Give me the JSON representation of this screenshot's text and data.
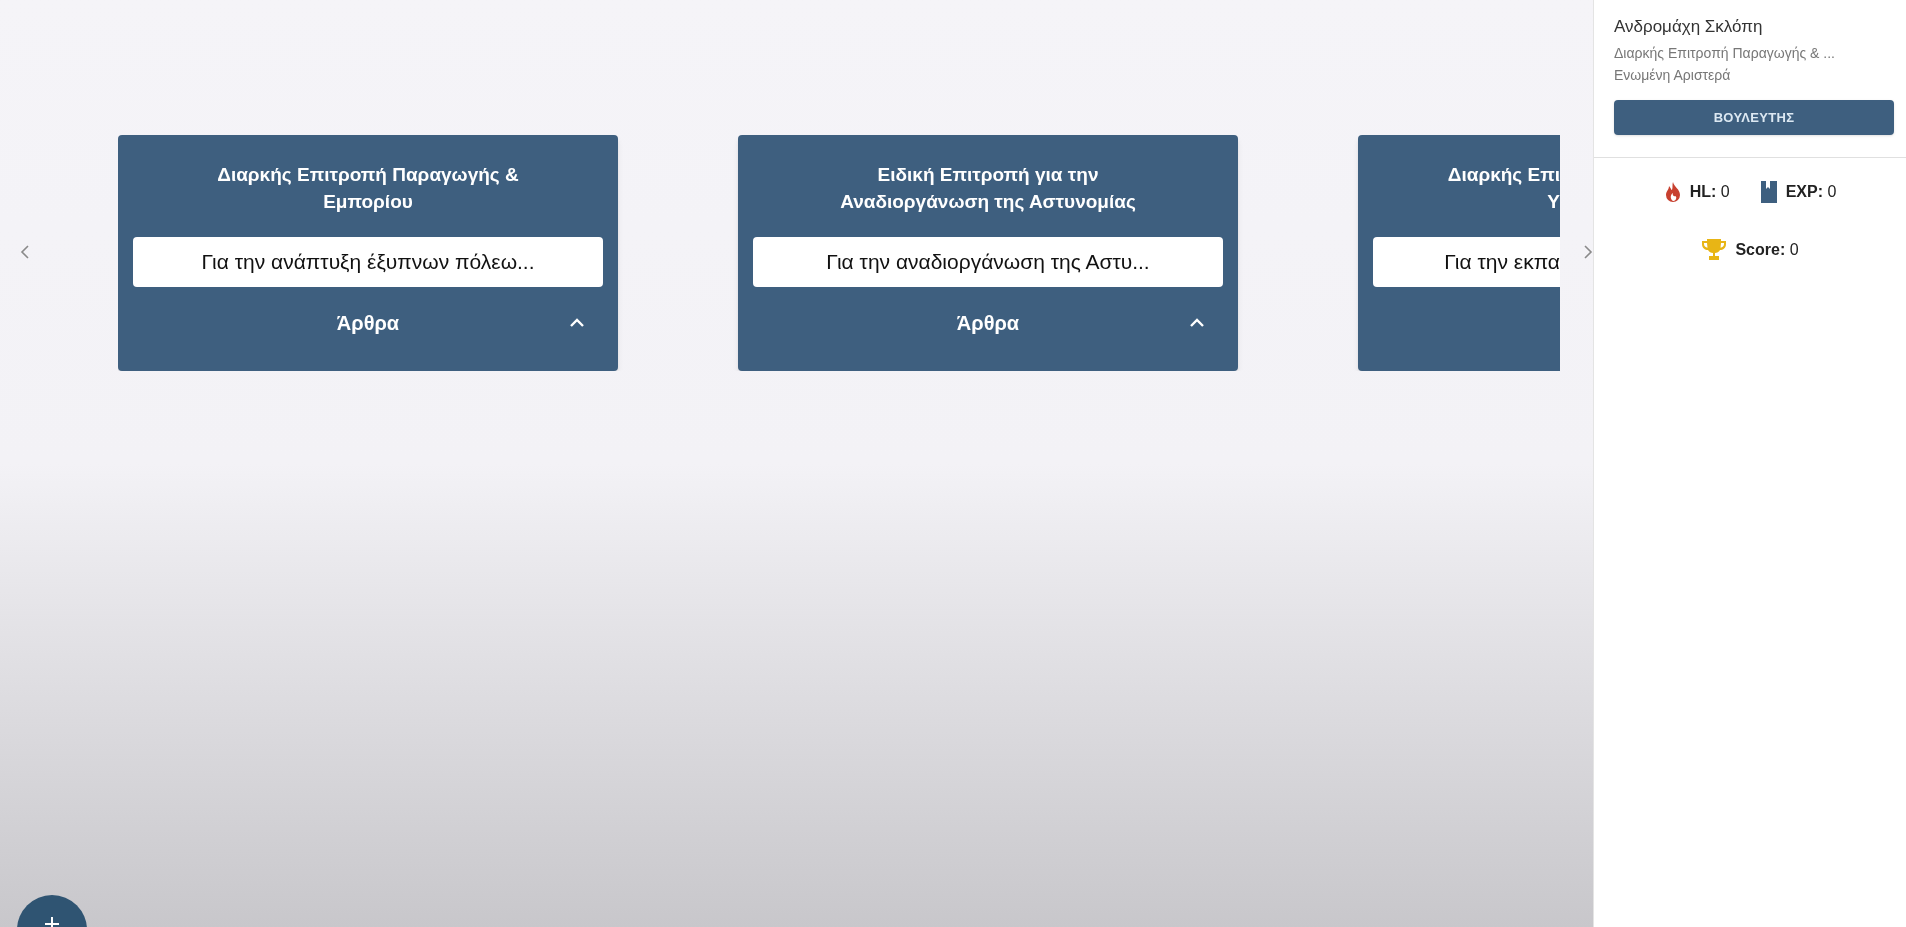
{
  "carousel": {
    "cards": [
      {
        "kind": "full",
        "title": "Διαρκής Επιτροπή Παραγωγής & Εμπορίου",
        "summary": "Για την ανάπτυξη έξυπνων πόλεω...",
        "section": "Άρθρα"
      },
      {
        "kind": "full",
        "title": "Ειδική Επιτροπή για την Αναδιοργάνωση της Αστυνομίας",
        "summary": "Για την αναδιοργάνωση της Αστυ...",
        "section": "Άρθρα"
      },
      {
        "kind": "partial",
        "title_lines": [
          "Διαρκής Επι",
          "Υ"
        ],
        "summary": "Για την εκπα"
      }
    ]
  },
  "profile": {
    "name": "Ανδρομάχη Σκλόπη",
    "committee": "Διαρκής Επιτροπή Παραγωγής & ...",
    "party": "Ενωμένη Αριστερά",
    "role_button": "ΒΟΥΛΕΥΤΗΣ"
  },
  "stats": [
    {
      "kind": "flame",
      "text": "**HL:** 0"
    },
    {
      "kind": "book",
      "text": "**EXP:** 0"
    },
    {
      "kind": "trophy",
      "text": "**Score:** 0"
    }
  ]
}
